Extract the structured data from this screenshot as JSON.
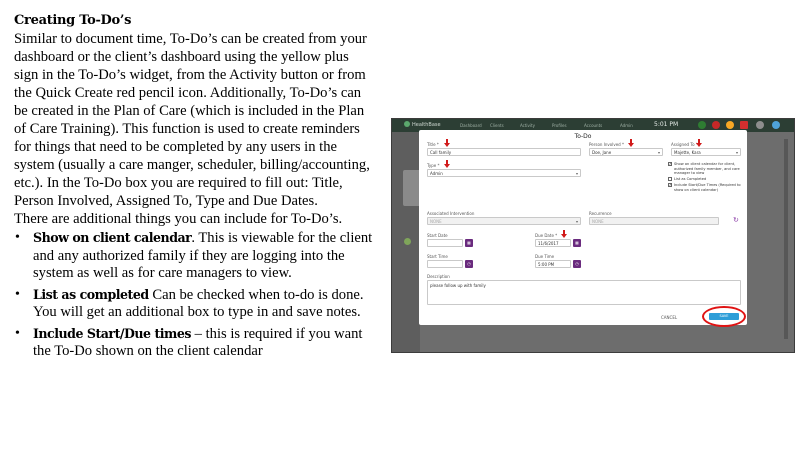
{
  "document": {
    "title": "Creating To-Do’s",
    "paragraphs": [
      "Similar to document time, To-Do’s can be created from your dashboard or the client’s dashboard using the yellow plus sign in the To-Do’s widget, from the Activity button or from the Quick Create red pencil icon. Additionally, To-Do’s can be created in the Plan of Care (which is included in the Plan of Care Training). This function is used to create reminders for things that need to be completed by any users in the system (usually a care manger, scheduler, billing/accounting, etc.). In the To-Do box you are required to fill out: Title, Person Involved, Assigned To, Type and Due Dates.",
      "There are additional things you can include for To-Do’s."
    ],
    "bullets": [
      {
        "term": "Show on client calendar",
        "punct": ".",
        "text": " This is viewable for the client and any authorized family if they are logging into the system as well as for care managers to view."
      },
      {
        "term": "List as completed",
        "punct": "",
        "text": " Can be checked when to-do is done. You will get an additional box to type in and save notes."
      },
      {
        "term": "Include Start/Due times",
        "punct": "",
        "text": " – this is required if you want the To-Do shown on the client calendar"
      }
    ]
  },
  "app": {
    "logo": "HealthBase",
    "nav": [
      "Dashboard",
      "Clients",
      "Activity",
      "Profiles",
      "Accounts",
      "Admin"
    ],
    "time": "5:01 PM"
  },
  "modal": {
    "title": "To-Do",
    "title_label": "Title *",
    "title_value": "Call family",
    "person_label": "Person Involved *",
    "person_value": "Doe, Jane",
    "assigned_label": "Assigned To *",
    "assigned_value": "Majette, Kara",
    "type_label": "Type *",
    "type_value": "Admin",
    "checkboxes": [
      {
        "checked": true,
        "label": "Show on client calendar for client, authorized family member, and care manager to view"
      },
      {
        "checked": false,
        "label": "List as Completed"
      },
      {
        "checked": true,
        "label": "Include Start/Due Times (Required to show on client calendar)"
      }
    ],
    "intervention_label": "Associated Intervention",
    "intervention_value": "NONE",
    "recurrence_label": "Recurrence",
    "recurrence_value": "NONE",
    "start_date_label": "Start Date",
    "start_date_value": "",
    "due_date_label": "Due Date *",
    "due_date_value": "11/6/2017",
    "start_time_label": "Start Time",
    "start_time_value": "",
    "due_time_label": "Due Time",
    "due_time_value": "5:00 PM",
    "description_label": "Description",
    "description_value": "please follow up with family",
    "cancel_label": "CANCEL",
    "save_label": "SAVE"
  }
}
